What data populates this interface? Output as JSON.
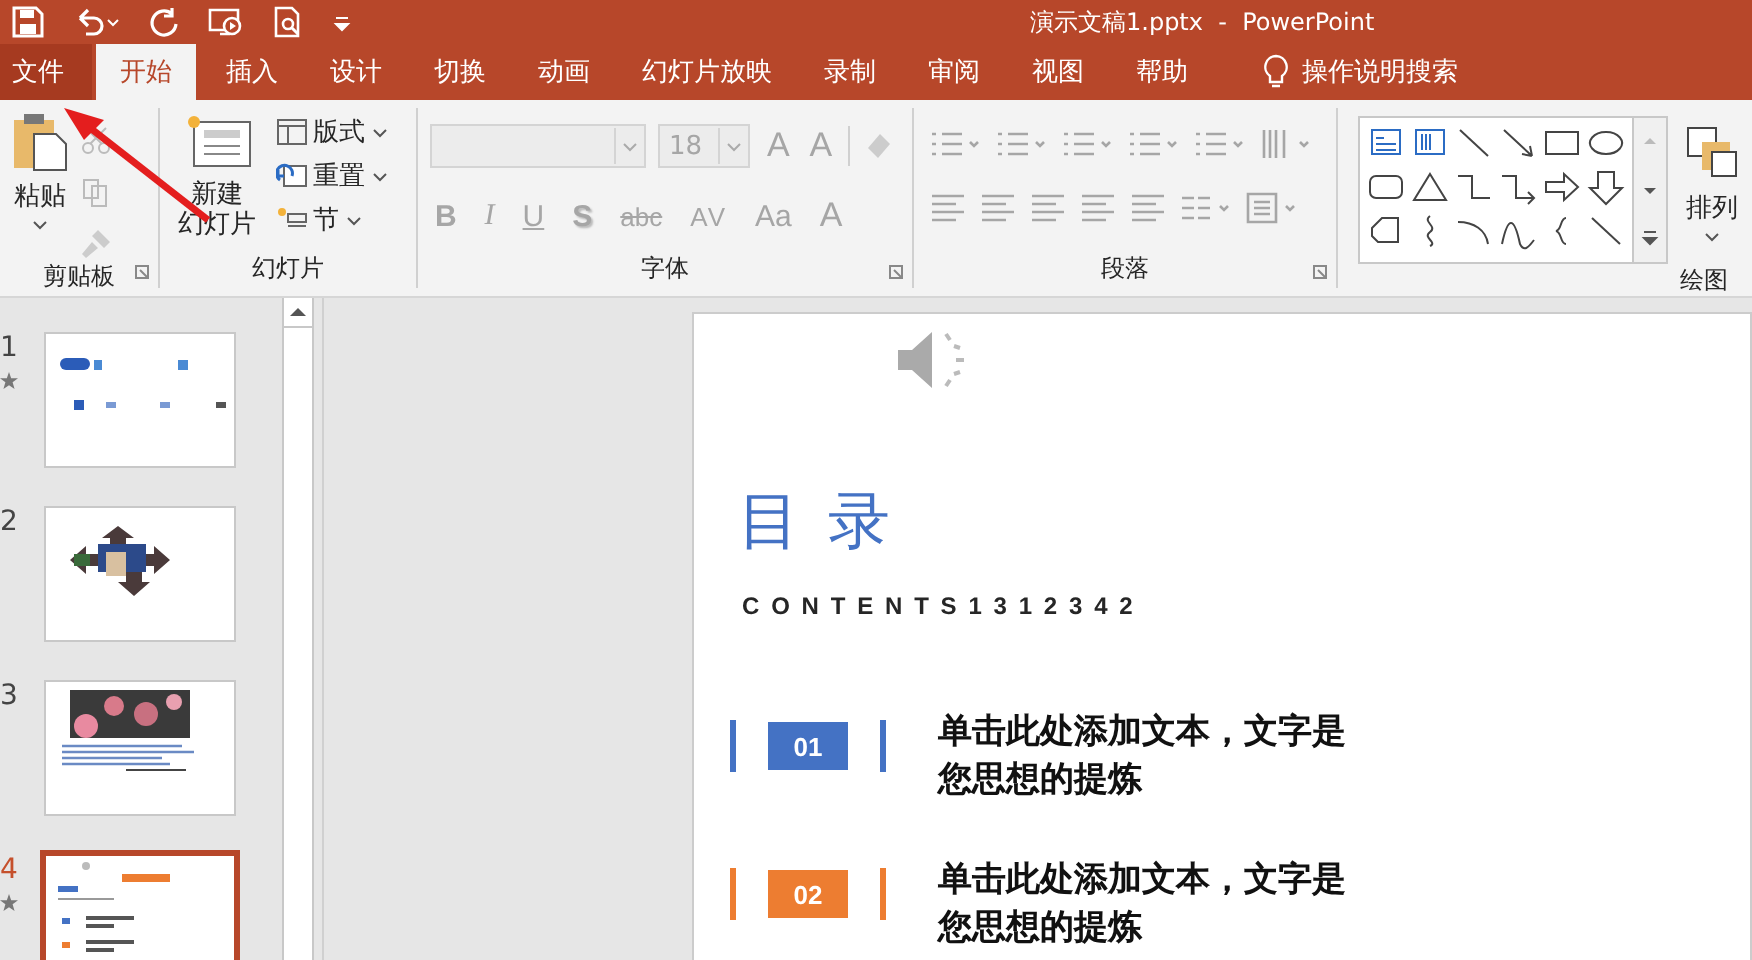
{
  "window": {
    "title": "演示文稿1.pptx  -  PowerPoint"
  },
  "tabs": [
    {
      "label": "文件",
      "kind": "file",
      "selected": false
    },
    {
      "label": "开始",
      "kind": "tab",
      "selected": true
    },
    {
      "label": "插入",
      "kind": "tab",
      "selected": false
    },
    {
      "label": "设计",
      "kind": "tab",
      "selected": false
    },
    {
      "label": "切换",
      "kind": "tab",
      "selected": false
    },
    {
      "label": "动画",
      "kind": "tab",
      "selected": false
    },
    {
      "label": "幻灯片放映",
      "kind": "tab",
      "selected": false
    },
    {
      "label": "录制",
      "kind": "tab",
      "selected": false
    },
    {
      "label": "审阅",
      "kind": "tab",
      "selected": false
    },
    {
      "label": "视图",
      "kind": "tab",
      "selected": false
    },
    {
      "label": "帮助",
      "kind": "tab",
      "selected": false
    }
  ],
  "tell_me": {
    "placeholder": "操作说明搜索"
  },
  "ribbon": {
    "clipboard": {
      "label": "剪贴板",
      "paste": "粘贴"
    },
    "slides": {
      "label": "幻灯片",
      "new_slide": [
        "新建",
        "幻灯片"
      ],
      "buttons": [
        "版式",
        "重置",
        "节"
      ]
    },
    "font": {
      "label": "字体",
      "disabled": true,
      "size": "18",
      "grow": "A",
      "shrink": "A",
      "styles": [
        {
          "label": "B",
          "kind": "bold"
        },
        {
          "label": "I",
          "kind": "italic"
        },
        {
          "label": "U",
          "kind": "underline"
        },
        {
          "label": "S",
          "kind": "shadow"
        },
        {
          "label": "abc",
          "kind": "strike"
        },
        {
          "label": "AV",
          "kind": "spacing"
        },
        {
          "label": "Aa",
          "kind": "case"
        },
        {
          "label": "A",
          "kind": "color"
        }
      ]
    },
    "paragraph": {
      "label": "段落",
      "disabled": true
    },
    "drawing": {
      "label": "绘图",
      "arrange": "排列"
    }
  },
  "thumbnails": [
    {
      "number": "1",
      "kind": "toc",
      "starred": true,
      "selected": false
    },
    {
      "number": "2",
      "kind": "arrows",
      "starred": false,
      "selected": false
    },
    {
      "number": "3",
      "kind": "photo",
      "starred": false,
      "selected": false
    },
    {
      "number": "4",
      "kind": "toc_small",
      "starred": true,
      "selected": true
    }
  ],
  "slide": {
    "title": "目 录",
    "subtitle": "CONTENTS1312342",
    "items": [
      {
        "number": "01",
        "text": "单击此处添加文本，文字是您思想的提炼",
        "color": "#4472c4"
      },
      {
        "number": "02",
        "text": "单击此处添加文本，文字是您思想的提炼",
        "color": "#ed7d31"
      }
    ]
  }
}
